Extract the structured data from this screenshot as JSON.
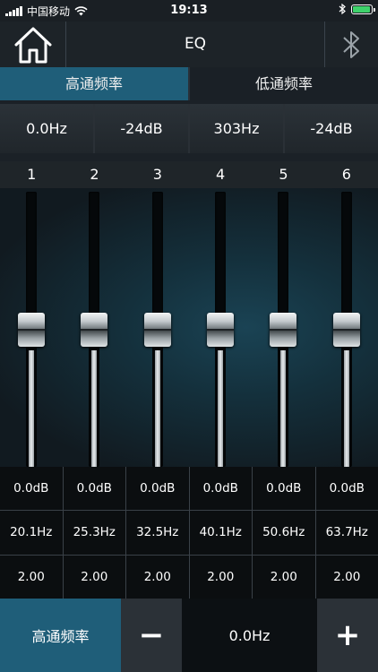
{
  "status_bar": {
    "carrier": "中国移动",
    "time": "19:13",
    "battery_level": 0.95,
    "icons": [
      "signal-icon",
      "wifi-icon",
      "bluetooth-icon",
      "battery-icon"
    ]
  },
  "header": {
    "title": "EQ",
    "home_icon": "home-icon",
    "bluetooth_icon": "bluetooth-icon"
  },
  "tabs": [
    {
      "label": "高通频率",
      "active": true
    },
    {
      "label": "低通频率",
      "active": false
    }
  ],
  "filters": [
    "0.0Hz",
    "-24dB",
    "303Hz",
    "-24dB"
  ],
  "channels": [
    {
      "number": "1",
      "gain": "0.0dB",
      "freq": "20.1Hz",
      "q": "2.00",
      "level": 0.5
    },
    {
      "number": "2",
      "gain": "0.0dB",
      "freq": "25.3Hz",
      "q": "2.00",
      "level": 0.5
    },
    {
      "number": "3",
      "gain": "0.0dB",
      "freq": "32.5Hz",
      "q": "2.00",
      "level": 0.5
    },
    {
      "number": "4",
      "gain": "0.0dB",
      "freq": "40.1Hz",
      "q": "2.00",
      "level": 0.5
    },
    {
      "number": "5",
      "gain": "0.0dB",
      "freq": "50.6Hz",
      "q": "2.00",
      "level": 0.5
    },
    {
      "number": "6",
      "gain": "0.0dB",
      "freq": "63.7Hz",
      "q": "2.00",
      "level": 0.5
    }
  ],
  "bottom_bar": {
    "label": "高通频率",
    "minus": "−",
    "value": "0.0Hz",
    "plus": "+"
  },
  "colors": {
    "accent": "#1f5e79",
    "background": "#1b2127"
  }
}
